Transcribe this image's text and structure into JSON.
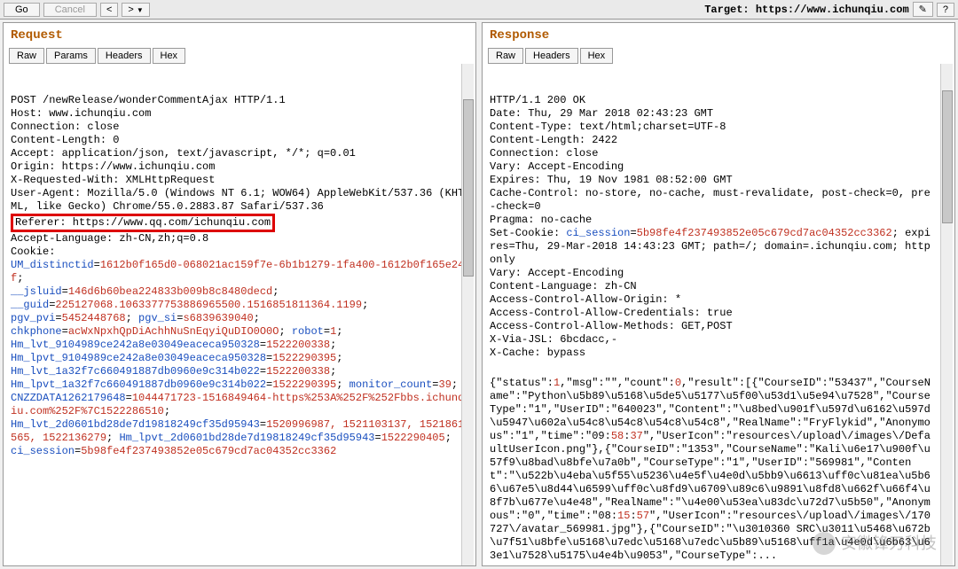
{
  "toolbar": {
    "go": "Go",
    "cancel": "Cancel",
    "prev": "<",
    "next": ">",
    "target_label": "Target: https://www.ichunqiu.com"
  },
  "request": {
    "title": "Request",
    "tabs": {
      "raw": "Raw",
      "params": "Params",
      "headers": "Headers",
      "hex": "Hex"
    },
    "lines": [
      {
        "t": "plain",
        "v": "POST /newRelease/wonderCommentAjax HTTP/1.1"
      },
      {
        "t": "plain",
        "v": "Host: www.ichunqiu.com"
      },
      {
        "t": "plain",
        "v": "Connection: close"
      },
      {
        "t": "plain",
        "v": "Content-Length: 0"
      },
      {
        "t": "plain",
        "v": "Accept: application/json, text/javascript, */*; q=0.01"
      },
      {
        "t": "plain",
        "v": "Origin: https://www.ichunqiu.com"
      },
      {
        "t": "plain",
        "v": "X-Requested-With: XMLHttpRequest"
      },
      {
        "t": "plain",
        "v": "User-Agent: Mozilla/5.0 (Windows NT 6.1; WOW64) AppleWebKit/537.36 (KHTML, like Gecko) Chrome/55.0.2883.87 Safari/537.36"
      },
      {
        "t": "box",
        "v": "Referer: https://www.qq.com/ichunqiu.com"
      },
      {
        "t": "plain",
        "v": "Accept-Language: zh-CN,zh;q=0.8"
      },
      {
        "t": "plain",
        "v": "Cookie:"
      },
      {
        "t": "kv",
        "k": "UM_distinctid",
        "v": "1612b0f165d0-068021ac159f7e-6b1b1279-1fa400-1612b0f165e24f",
        "sep": ";"
      },
      {
        "t": "kv",
        "k": "__jsluid",
        "v": "146d6b60bea224833b009b8c8480decd",
        "sep": ";"
      },
      {
        "t": "kv",
        "k": "__guid",
        "v": "225127068.1063377753886965500.1516851811364.1199",
        "sep": ";"
      },
      {
        "t": "kvline",
        "items": [
          {
            "k": "pgv_pvi",
            "v": "5452448768",
            "sep": "; "
          },
          {
            "k": "pgv_si",
            "v": "s6839639040",
            "sep": ";"
          }
        ]
      },
      {
        "t": "kvline",
        "items": [
          {
            "k": "chkphone",
            "v": "acWxNpxhQpDiAchhNuSnEqyiQuDIO0O0O",
            "sep": "; "
          },
          {
            "k": "robot",
            "v": "1",
            "sep": ";"
          }
        ]
      },
      {
        "t": "kv",
        "k": "Hm_lvt_9104989ce242a8e03049eaceca950328",
        "v": "1522200338",
        "sep": ";"
      },
      {
        "t": "kv",
        "k": "Hm_lpvt_9104989ce242a8e03049eaceca950328",
        "v": "1522290395",
        "sep": ";"
      },
      {
        "t": "kv",
        "k": "Hm_lvt_1a32f7c660491887db0960e9c314b022",
        "v": "1522200338",
        "sep": ";"
      },
      {
        "t": "kvline",
        "items": [
          {
            "k": "Hm_lpvt_1a32f7c660491887db0960e9c314b022",
            "v": "1522290395",
            "sep": "; "
          },
          {
            "k": "monitor_count",
            "v": "39",
            "sep": ";"
          }
        ]
      },
      {
        "t": "kv",
        "k": "CNZZDATA1262179648",
        "v": "1044471723-1516849464-https%253A%252F%252Fbbs.ichunqiu.com%252F%7C1522286510",
        "sep": ";"
      },
      {
        "t": "kvline",
        "items": [
          {
            "k": "Hm_lvt_2d0601bd28de7d19818249cf35d95943",
            "v": "1520996987, 1521103137, 1521861565, 1522136279",
            "sep": "; "
          },
          {
            "k": "Hm_lpvt_2d0601bd28de7d19818249cf35d95943",
            "v": "1522290405",
            "sep": ";"
          }
        ]
      },
      {
        "t": "kv",
        "k": "ci_session",
        "v": "5b98fe4f237493852e05c679cd7ac04352cc3362",
        "sep": ""
      }
    ]
  },
  "response": {
    "title": "Response",
    "tabs": {
      "raw": "Raw",
      "headers": "Headers",
      "hex": "Hex"
    },
    "header_lines": [
      {
        "t": "plain",
        "v": "HTTP/1.1 200 OK"
      },
      {
        "t": "plain",
        "v": "Date: Thu, 29 Mar 2018 02:43:23 GMT"
      },
      {
        "t": "plain",
        "v": "Content-Type: text/html;charset=UTF-8"
      },
      {
        "t": "plain",
        "v": "Content-Length: 2422"
      },
      {
        "t": "plain",
        "v": "Connection: close"
      },
      {
        "t": "plain",
        "v": "Vary: Accept-Encoding"
      },
      {
        "t": "plain",
        "v": "Expires: Thu, 19 Nov 1981 08:52:00 GMT"
      },
      {
        "t": "plain",
        "v": "Cache-Control: no-store, no-cache, must-revalidate, post-check=0, pre-check=0"
      },
      {
        "t": "plain",
        "v": "Pragma: no-cache"
      },
      {
        "t": "setcookie",
        "pre": "Set-Cookie: ",
        "k": "ci_session",
        "v": "5b98fe4f237493852e05c679cd7ac04352cc3362",
        "rest": "; expires=Thu, 29-Mar-2018 14:43:23 GMT; path=/; domain=.ichunqiu.com; httponly"
      },
      {
        "t": "plain",
        "v": "Vary: Accept-Encoding"
      },
      {
        "t": "plain",
        "v": "Content-Language: zh-CN"
      },
      {
        "t": "plain",
        "v": "Access-Control-Allow-Origin: *"
      },
      {
        "t": "plain",
        "v": "Access-Control-Allow-Credentials: true"
      },
      {
        "t": "plain",
        "v": "Access-Control-Allow-Methods: GET,POST"
      },
      {
        "t": "plain",
        "v": "X-Via-JSL: 6bcdacc,-"
      },
      {
        "t": "plain",
        "v": "X-Cache: bypass"
      }
    ],
    "body": "{\"status\":1,\"msg\":\"\",\"count\":0,\"result\":[{\"CourseID\":\"53437\",\"CourseName\":\"Python\\u5b89\\u5168\\u5de5\\u5177\\u5f00\\u53d1\\u5e94\\u7528\",\"CourseType\":\"1\",\"UserID\":\"640023\",\"Content\":\"\\u8bed\\u901f\\u597d\\u6162\\u597d\\u5947\\u602a\\u54c8\\u54c8\\u54c8\\u54c8\",\"RealName\":\"FryFlykid\",\"Anonymous\":\"1\",\"time\":\"09:58:37\",\"UserIcon\":\"resources\\/upload\\/images\\/DefaultUserIcon.png\"},{\"CourseID\":\"1353\",\"CourseName\":\"Kali\\u6e17\\u900f\\u57f9\\u8bad\\u8bfe\\u7a0b\",\"CourseType\":\"1\",\"UserID\":\"569981\",\"Content\":\"\\u522b\\u4eba\\u5f55\\u5236\\u4e5f\\u4e0d\\u5bb9\\u6613\\uff0c\\u81ea\\u5b66\\u67e5\\u8d44\\u6599\\uff0c\\u8fd9\\u6709\\u89c6\\u9891\\u8fd8\\u662f\\u66f4\\u8f7b\\u677e\\u4e48\",\"RealName\":\"\\u4e00\\u53ea\\u83dc\\u72d7\\u5b50\",\"Anonymous\":\"0\",\"time\":\"08:15:57\",\"UserIcon\":\"resources\\/upload\\/images\\/170727\\/avatar_569981.jpg\"},{\"CourseID\":\"\\u3010360 SRC\\u3011\\u5468\\u672b\\u7f51\\u8bfe\\u5168\\u7edc\\u5168\\u7edc\\u5b89\\u5168\\uff1a\\u4e0d\\u6b63\\u63e1\\u7528\\u5175\\u4e4b\\u9053\",\"CourseType\":..."
  },
  "watermark": "安徽锋刃科技"
}
